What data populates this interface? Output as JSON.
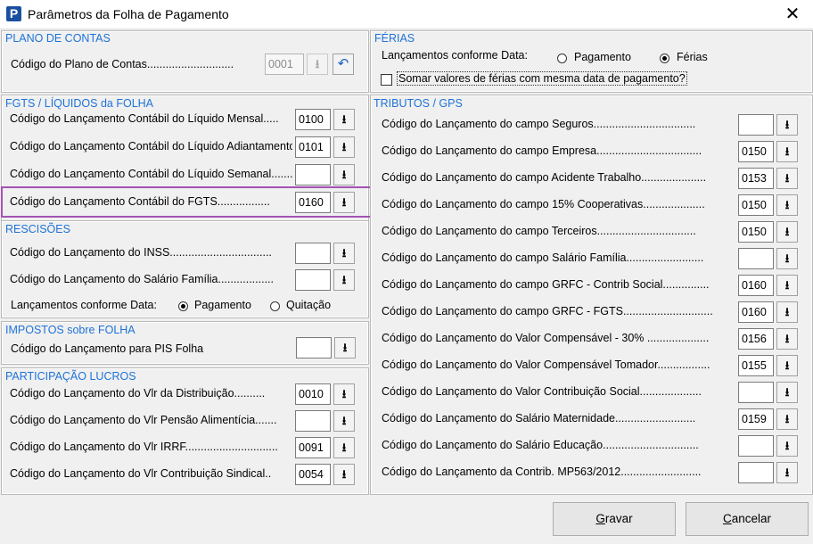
{
  "window": {
    "title": "Parâmetros da Folha de Pagamento",
    "icon_letter": "P"
  },
  "plano_contas": {
    "title": "PLANO DE CONTAS",
    "label": "Código do Plano de Contas............................",
    "code": "0001"
  },
  "fgts": {
    "title": "FGTS / LÍQUIDOS da FOLHA",
    "items": [
      {
        "label": "Código do Lançamento Contábil do Líquido Mensal.....",
        "code": "0100"
      },
      {
        "label": "Código do Lançamento Contábil do Líquido Adiantamento",
        "code": "0101"
      },
      {
        "label": "Código do Lançamento Contábil do Líquido Semanal........",
        "code": ""
      },
      {
        "label": "Código do Lançamento Contábil do FGTS.................",
        "code": "0160"
      }
    ]
  },
  "rescisoes": {
    "title": "RESCISÕES",
    "items": [
      {
        "label": "Código do Lançamento do INSS.................................",
        "code": ""
      },
      {
        "label": "Código do Lançamento do Salário Família..................",
        "code": ""
      }
    ],
    "radio_label": "Lançamentos conforme Data:",
    "options": [
      "Pagamento",
      "Quitação"
    ],
    "selected": "Pagamento"
  },
  "impostos": {
    "title": "IMPOSTOS sobre FOLHA",
    "label": "Código do Lançamento para PIS Folha",
    "code": ""
  },
  "participacao": {
    "title": "PARTICIPAÇÃO  LUCROS",
    "items": [
      {
        "label": "Código do Lançamento do Vlr da Distribuição..........",
        "code": "0010"
      },
      {
        "label": "Código do Lançamento do Vlr Pensão Alimentícia.......",
        "code": ""
      },
      {
        "label": "Código do Lançamento do Vlr IRRF..............................",
        "code": "0091"
      },
      {
        "label": "Código do Lançamento do Vlr Contribuição Sindical..",
        "code": "0054"
      }
    ]
  },
  "ferias": {
    "title": "FÉRIAS",
    "radio_label": "Lançamentos conforme Data:",
    "options": [
      "Pagamento",
      "Férias"
    ],
    "selected": "Férias",
    "checkbox_label": "Somar valores de férias com mesma data de pagamento?"
  },
  "tributos": {
    "title": "TRIBUTOS  /  GPS",
    "items": [
      {
        "label": "Código do Lançamento do campo Seguros.................................",
        "code": ""
      },
      {
        "label": "Código do Lançamento do campo Empresa..................................",
        "code": "0150"
      },
      {
        "label": "Código do Lançamento do campo Acidente Trabalho.....................",
        "code": "0153"
      },
      {
        "label": "Código do Lançamento do campo 15% Cooperativas....................",
        "code": "0150"
      },
      {
        "label": "Código do Lançamento do campo Terceiros................................",
        "code": "0150"
      },
      {
        "label": "Código do Lançamento do campo Salário Família.........................",
        "code": ""
      },
      {
        "label": "Código do Lançamento do campo GRFC - Contrib Social...............",
        "code": "0160"
      },
      {
        "label": "Código do Lançamento do campo GRFC - FGTS.............................",
        "code": "0160"
      },
      {
        "label": "Código do Lançamento do Valor Compensável - 30% ....................",
        "code": "0156"
      },
      {
        "label": "Código do Lançamento do Valor Compensável Tomador.................",
        "code": "0155"
      },
      {
        "label": "Código do Lançamento do Valor Contribuição Social....................",
        "code": ""
      },
      {
        "label": "Código do Lançamento do Salário Maternidade..........................",
        "code": "0159"
      },
      {
        "label": "Código do Lançamento do Salário Educação...............................",
        "code": ""
      },
      {
        "label": "Código do Lançamento da Contrib. MP563/2012..........................",
        "code": ""
      }
    ]
  },
  "buttons": {
    "save": "Gravar",
    "save_key": "G",
    "cancel": "Cancelar",
    "cancel_key": "C"
  },
  "colors": {
    "section_title": "#1e73d8",
    "highlight": "#a452b4"
  },
  "icons": {
    "lookup": "down-arrow-icon",
    "undo": "undo-arrow-icon"
  }
}
